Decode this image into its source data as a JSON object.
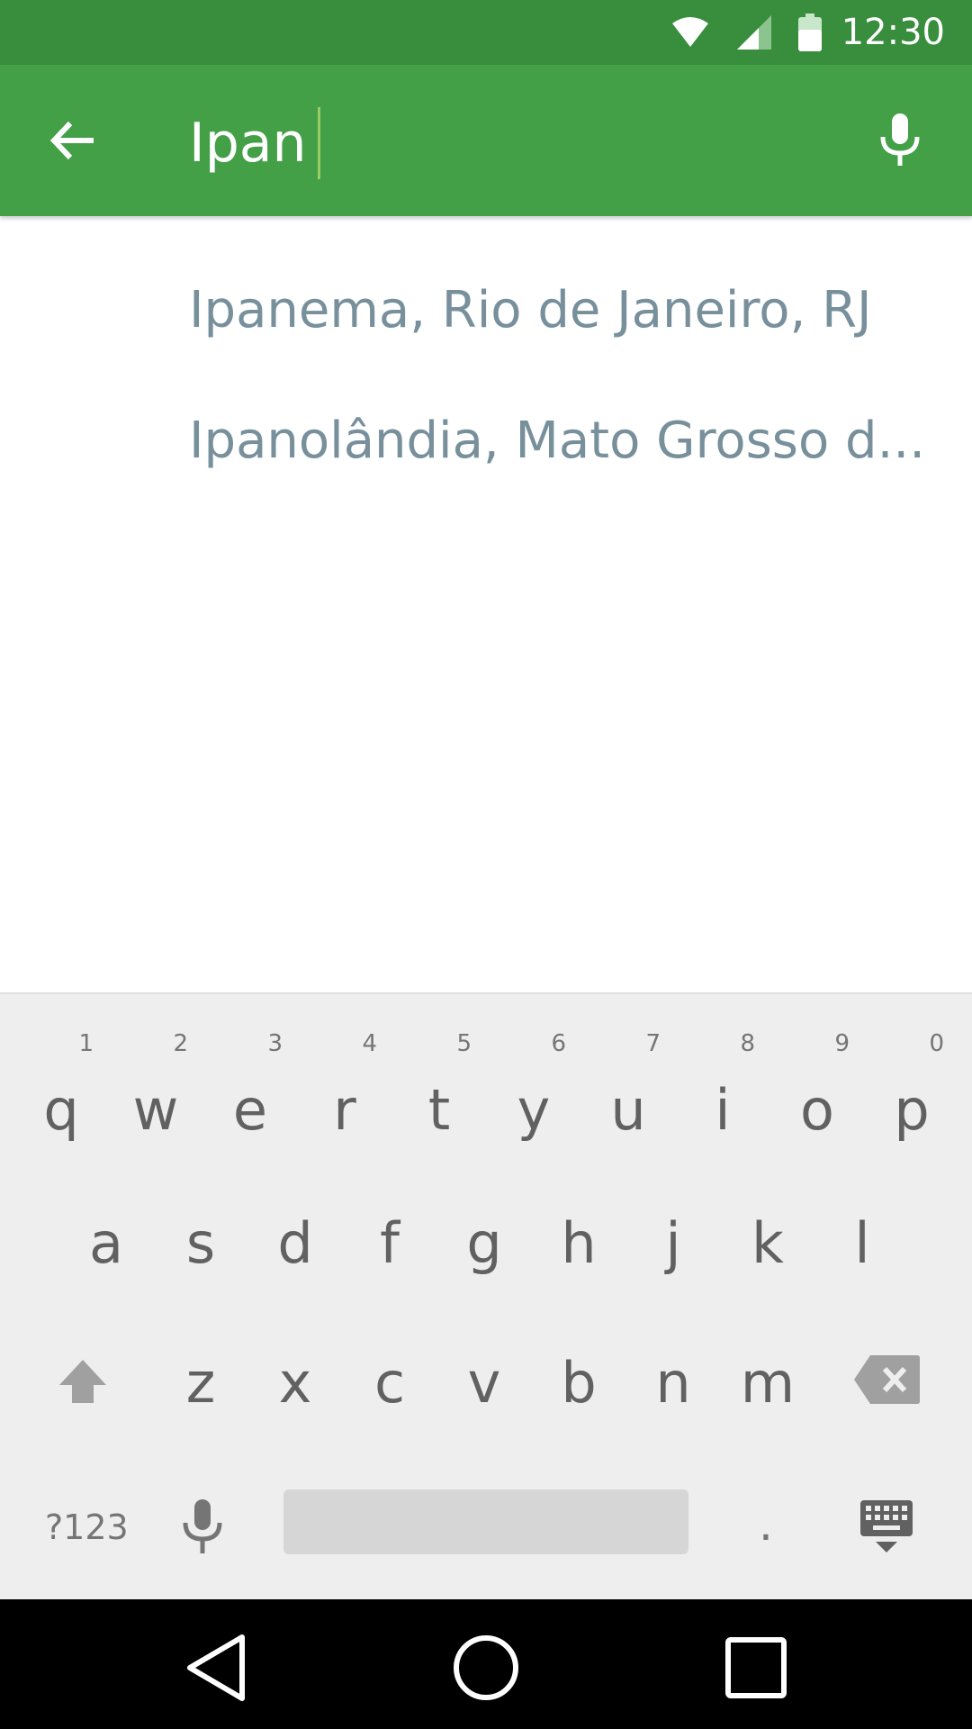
{
  "status_bar": {
    "time": "12:30",
    "icons": [
      "wifi-icon",
      "signal-icon",
      "battery-icon"
    ]
  },
  "search": {
    "query": "Ipan",
    "back_icon": "arrow-back-icon",
    "voice_icon": "mic-icon"
  },
  "suggestions": [
    {
      "label": "Ipanema, Rio de Janeiro, RJ"
    },
    {
      "label": "Ipanolândia, Mato Grosso d..."
    }
  ],
  "keyboard": {
    "row1": [
      {
        "key": "q",
        "hint": "1"
      },
      {
        "key": "w",
        "hint": "2"
      },
      {
        "key": "e",
        "hint": "3"
      },
      {
        "key": "r",
        "hint": "4"
      },
      {
        "key": "t",
        "hint": "5"
      },
      {
        "key": "y",
        "hint": "6"
      },
      {
        "key": "u",
        "hint": "7"
      },
      {
        "key": "i",
        "hint": "8"
      },
      {
        "key": "o",
        "hint": "9"
      },
      {
        "key": "p",
        "hint": "0"
      }
    ],
    "row2": [
      "a",
      "s",
      "d",
      "f",
      "g",
      "h",
      "j",
      "k",
      "l"
    ],
    "row3": [
      "z",
      "x",
      "c",
      "v",
      "b",
      "n",
      "m"
    ],
    "symbols_label": "?123",
    "period": "."
  },
  "colors": {
    "status_bar": "#388e3c",
    "app_bar": "#43a047",
    "suggestion_text": "#78909c",
    "keyboard_bg": "#eeeeee"
  }
}
